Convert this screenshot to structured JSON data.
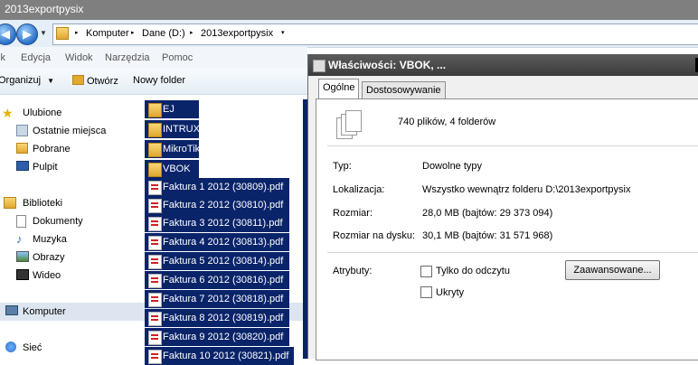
{
  "window": {
    "title": "2013exportpysix"
  },
  "address": {
    "crumbs": [
      "Komputer",
      "Dane (D:)",
      "2013exportpysix"
    ]
  },
  "menu": [
    "ik",
    "Edycja",
    "Widok",
    "Narzędzia",
    "Pomoc"
  ],
  "toolbar": {
    "organize": "Organizuj",
    "open": "Otwórz",
    "new_folder": "Nowy folder"
  },
  "nav": {
    "favorites": "Ulubione",
    "recent": "Ostatnie miejsca",
    "downloads": "Pobrane",
    "desktop": "Pulpit",
    "libraries": "Biblioteki",
    "documents": "Dokumenty",
    "music": "Muzyka",
    "pictures": "Obrazy",
    "videos": "Wideo",
    "computer": "Komputer",
    "network": "Sieć"
  },
  "files": [
    {
      "name": "EJ",
      "type": "folder"
    },
    {
      "name": "INTRUX",
      "type": "folder"
    },
    {
      "name": "MikroTik",
      "type": "folder"
    },
    {
      "name": "VBOK",
      "type": "folder"
    },
    {
      "name": "Faktura 1 2012 (30809).pdf",
      "type": "pdf"
    },
    {
      "name": "Faktura 2 2012 (30810).pdf",
      "type": "pdf"
    },
    {
      "name": "Faktura 3 2012 (30811).pdf",
      "type": "pdf"
    },
    {
      "name": "Faktura 4 2012 (30813).pdf",
      "type": "pdf"
    },
    {
      "name": "Faktura 5 2012 (30814).pdf",
      "type": "pdf"
    },
    {
      "name": "Faktura 6 2012 (30816).pdf",
      "type": "pdf"
    },
    {
      "name": "Faktura 7 2012 (30818).pdf",
      "type": "pdf"
    },
    {
      "name": "Faktura 8 2012 (30819).pdf",
      "type": "pdf"
    },
    {
      "name": "Faktura 9 2012 (30820).pdf",
      "type": "pdf"
    },
    {
      "name": "Faktura 10 2012 (30821).pdf",
      "type": "pdf"
    }
  ],
  "dialog": {
    "title": "Właściwości: VBOK, ...",
    "tabs": [
      "Ogólne",
      "Dostosowywanie"
    ],
    "summary": "740 plików, 4 folderów",
    "type_label": "Typ:",
    "type_value": "Dowolne typy",
    "location_label": "Lokalizacja:",
    "location_value": "Wszystko wewnątrz folderu D:\\2013exportpysix",
    "size_label": "Rozmiar:",
    "size_value": "28,0 MB (bajtów: 29 373 094)",
    "disk_label": "Rozmiar na dysku:",
    "disk_value": "30,1 MB (bajtów: 31 571 968)",
    "attributes_label": "Atrybuty:",
    "readonly_label": "Tylko do odczytu",
    "hidden_label": "Ukryty",
    "advanced_button": "Zaawansowane..."
  }
}
